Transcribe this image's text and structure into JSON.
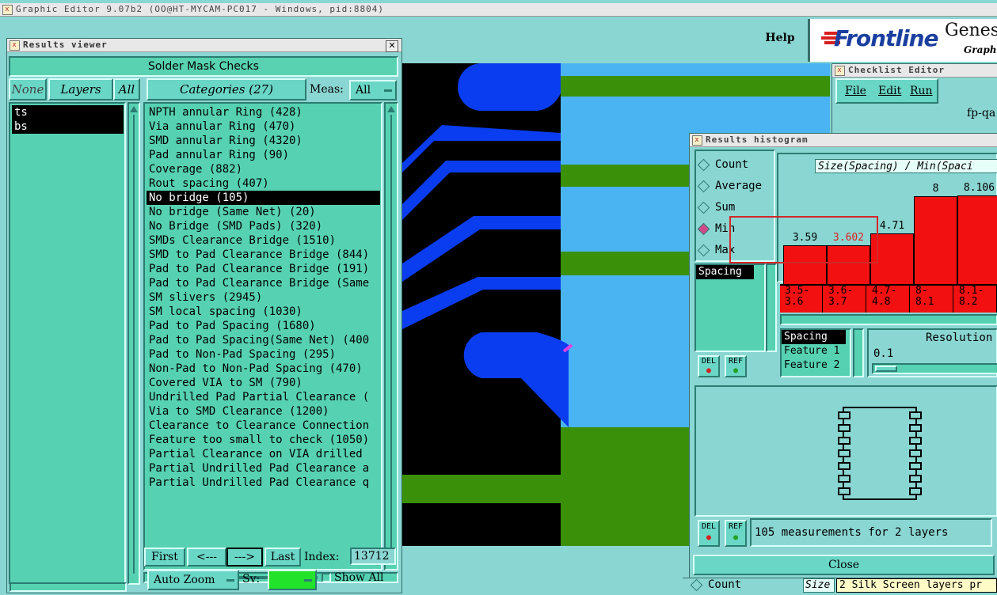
{
  "app": {
    "title": "Graphic Editor 9.07b2 (OO@HT-MYCAM-PC017 - Windows, pid:8804)",
    "help": "Help",
    "brand": "Frontline",
    "brand2": "Genes",
    "brand_sub": "Graphi"
  },
  "results_viewer": {
    "title": "Results viewer",
    "header": "Solder Mask Checks",
    "none_btn": "None",
    "layers_btn": "Layers",
    "all_btn": "All",
    "categories_btn": "Categories (27)",
    "meas_label": "Meas:",
    "meas_value": "All",
    "layers": [
      "ts",
      "bs"
    ],
    "categories": [
      "NPTH annular Ring (428)",
      "Via annular Ring (470)",
      "SMD annular Ring (4320)",
      "Pad annular Ring (90)",
      "Coverage (882)",
      "Rout spacing (407)",
      "No bridge (105)",
      "No bridge (Same Net) (20)",
      "No Bridge (SMD Pads) (320)",
      "SMDs Clearance Bridge (1510)",
      "SMD to Pad Clearance Bridge (844)",
      "Pad to Pad Clearance Bridge (191)",
      "Pad to Pad Clearance Bridge (Same",
      "SM slivers (2945)",
      "SM local spacing (1030)",
      "Pad to Pad Spacing (1680)",
      "Pad to Pad Spacing(Same Net) (400",
      "Pad to Non-Pad Spacing (295)",
      "Non-Pad to Non-Pad Spacing (470)",
      "Covered VIA to SM (790)",
      "Undrilled Pad Partial Clearance (",
      "Via to SMD Clearance (1200)",
      "Clearance to Clearance Connection",
      "Feature too small to check (1050)",
      "Partial Clearance on VIA drilled",
      "Partial Undrilled Pad Clearance a",
      "Partial Undrilled Pad Clearance q"
    ],
    "selected_index": 6,
    "first_btn": "First",
    "prev_btn": "<---",
    "next_btn": "--->",
    "last_btn": "Last",
    "index_label": "Index:",
    "index_value": "13712",
    "auto_zoom": "Auto Zoom",
    "sv_label": "Sv:",
    "show_all": "Show All"
  },
  "checklist": {
    "title": "Checklist Editor",
    "menu": [
      "File",
      "Edit",
      "Run"
    ],
    "name": "fp-qa"
  },
  "histogram": {
    "title": "Results histogram",
    "modes": [
      "Count",
      "Average",
      "Sum",
      "Min",
      "Max"
    ],
    "selected_mode": "Min",
    "chart_title": "Size(Spacing) / Min(Spaci",
    "measure": "Spacing",
    "del_btn": "DEL",
    "ref_btn": "REF",
    "fields": [
      "Spacing",
      "Feature 1",
      "Feature 2"
    ],
    "resolution_label": "Resolution",
    "resolution_value": "0.1",
    "status": "105 measurements for 2 layers",
    "close_btn": "Close",
    "chart_data": {
      "type": "bar",
      "categories": [
        "3.5-\n3.6",
        "3.6-\n3.7",
        "4.7-\n4.8",
        "8-\n8.1",
        "8.1-\n8.2"
      ],
      "category_labels": [
        [
          "3.5-",
          "3.6"
        ],
        [
          "3.6-",
          "3.7"
        ],
        [
          "4.7-",
          "4.8"
        ],
        [
          "8-",
          "8.1"
        ],
        [
          "8.1-",
          "8.2"
        ]
      ],
      "values": [
        3.59,
        3.602,
        4.71,
        8,
        8.106
      ],
      "value_labels": [
        "3.59",
        "3.602",
        "4.71",
        "8",
        "8.106"
      ],
      "highlight_index": 1,
      "title": "Size(Spacing) / Min(Spaci",
      "ylim": [
        0,
        8.5
      ]
    }
  },
  "bottom": {
    "count": "Count",
    "size": "Size",
    "tooltip": "2 Silk Screen layers pr"
  },
  "colors": {
    "panel": "#58d2b0",
    "bg": "#8ad6d2",
    "bar": "#f21010",
    "highlight": "#e02020"
  }
}
